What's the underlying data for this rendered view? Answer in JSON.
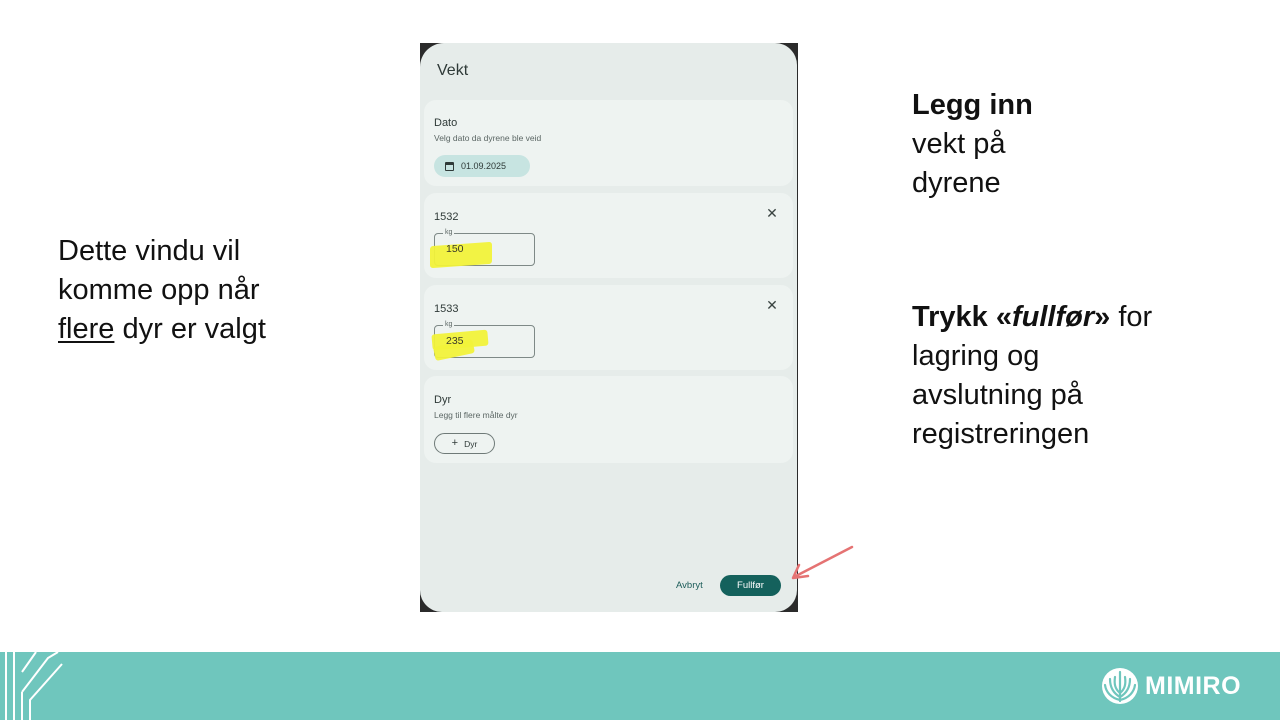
{
  "slide": {
    "left_text": {
      "line1": "Dette vindu vil",
      "line2": "komme opp når",
      "line3_underlined": "flere",
      "line3_rest": " dyr er valgt"
    },
    "right_top": {
      "bold": "Legg inn",
      "line2": "vekt på",
      "line3": "dyrene"
    },
    "right_bottom": {
      "bold": "Trykk «",
      "bolditalic": "fullfør",
      "bold_end": "»",
      "rest": " for",
      "line2": "lagring og",
      "line3": "avslutning på",
      "line4": "registreringen"
    }
  },
  "dialog": {
    "title": "Vekt",
    "date_card": {
      "title": "Dato",
      "subtitle": "Velg dato da dyrene ble veid",
      "date_value": "01.09.2025"
    },
    "animals": [
      {
        "id": "1532",
        "unit_label": "kg",
        "weight": "150"
      },
      {
        "id": "1533",
        "unit_label": "kg",
        "weight": "235"
      }
    ],
    "dyr_card": {
      "title": "Dyr",
      "subtitle": "Legg til flere målte dyr",
      "add_button_label": "Dyr"
    },
    "cancel_label": "Avbryt",
    "finish_label": "Fullfør"
  },
  "footer": {
    "logo_text": "MIMIRO",
    "color": "#6fc6bd"
  },
  "colors": {
    "primary": "#14615c",
    "highlight": "#f1f23a",
    "arrow": "#e57373"
  }
}
